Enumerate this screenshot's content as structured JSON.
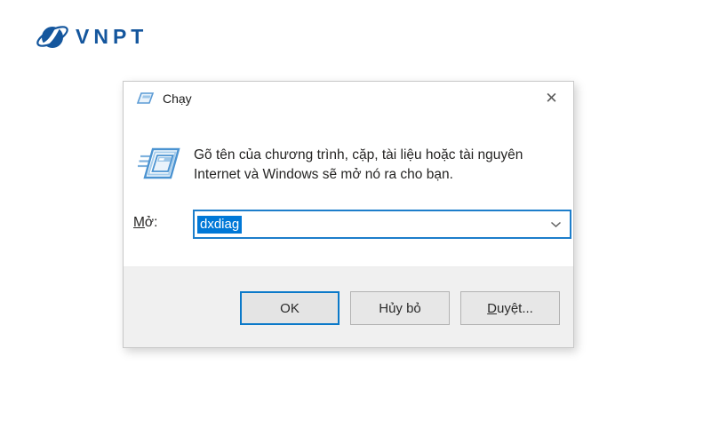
{
  "brand": {
    "name": "VNPT",
    "color": "#14569d"
  },
  "dialog": {
    "title": "Chạy",
    "close_symbol": "✕",
    "description": {
      "line1": "Gõ tên của chương trình, cặp, tài liệu hoặc tài nguyên",
      "line2": "Internet và Windows sẽ mở nó ra cho bạn."
    },
    "open_field": {
      "label_accesskey": "M",
      "label_rest": "ở:",
      "value": "dxdiag"
    },
    "buttons": {
      "ok": "OK",
      "cancel": "Hủy bỏ",
      "browse_accesskey": "D",
      "browse_rest": "uyệt..."
    },
    "colors": {
      "accent": "#0078d7",
      "selection_bg": "#0078d7",
      "selection_text": "#ffffff",
      "footer_bg": "#f0f0f0"
    }
  }
}
